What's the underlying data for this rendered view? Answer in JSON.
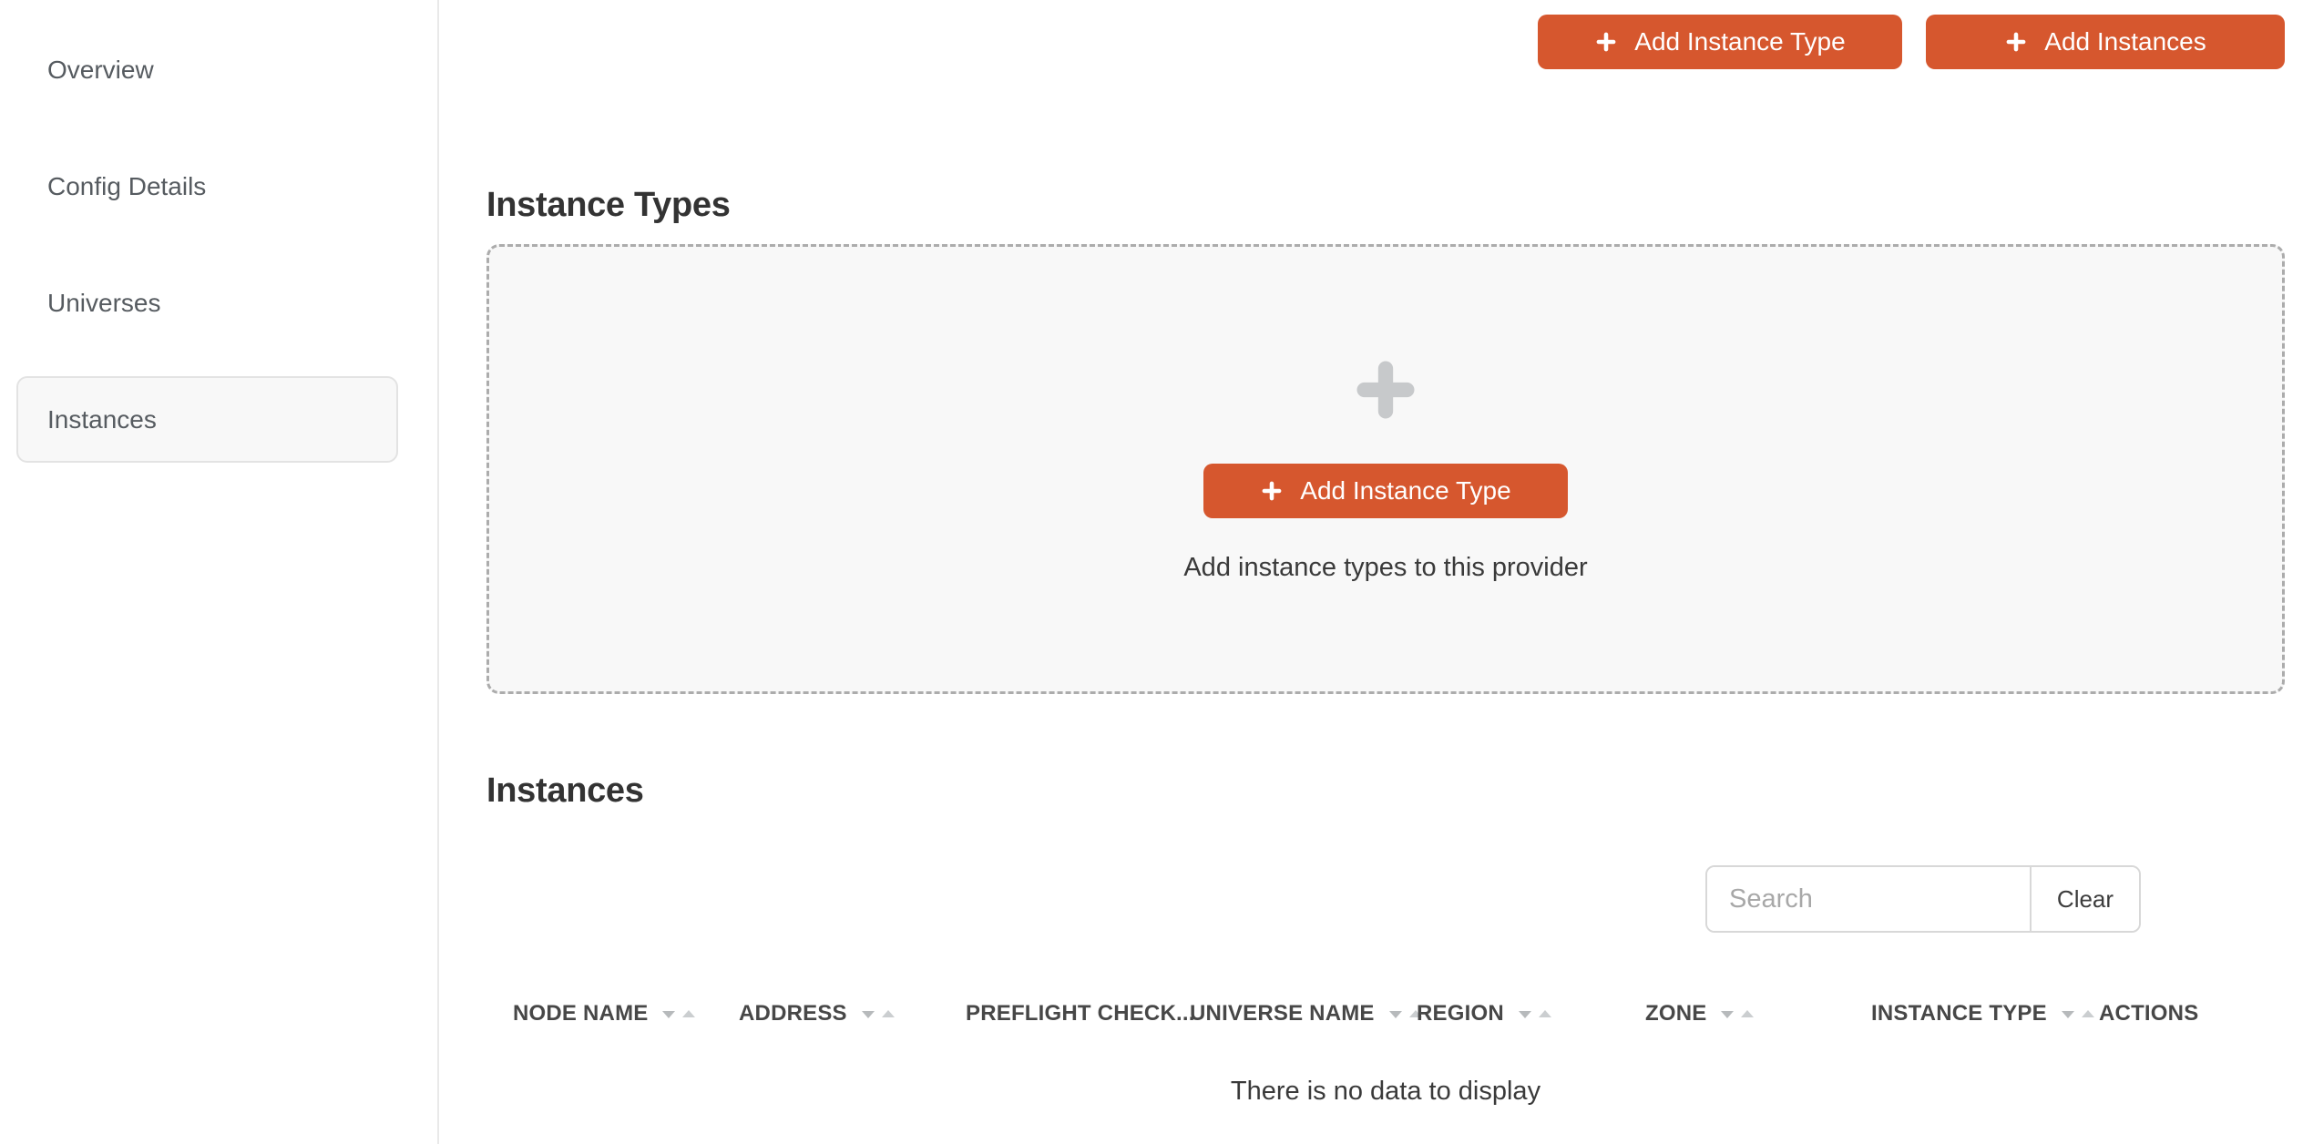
{
  "sidebar": {
    "items": [
      {
        "label": "Overview"
      },
      {
        "label": "Config Details"
      },
      {
        "label": "Universes"
      },
      {
        "label": "Instances"
      }
    ],
    "selected": "Instances"
  },
  "toolbar": {
    "add_instance_type_label": "Add Instance Type",
    "add_instances_label": "Add Instances"
  },
  "instance_types_section": {
    "title": "Instance Types",
    "empty_state": {
      "button_label": "Add Instance Type",
      "caption": "Add instance types to this provider"
    }
  },
  "instances_section": {
    "title": "Instances",
    "search": {
      "placeholder": "Search",
      "value": "",
      "clear_label": "Clear"
    },
    "table": {
      "columns": [
        {
          "label": "NODE NAME",
          "sortable": true
        },
        {
          "label": "ADDRESS",
          "sortable": true
        },
        {
          "label": "PREFLIGHT CHECK...",
          "sortable": false
        },
        {
          "label": "UNIVERSE NAME",
          "sortable": true
        },
        {
          "label": "REGION",
          "sortable": true
        },
        {
          "label": "ZONE",
          "sortable": true
        },
        {
          "label": "INSTANCE TYPE",
          "sortable": true
        },
        {
          "label": "ACTIONS",
          "sortable": false
        }
      ],
      "rows": [],
      "empty_message": "There is no data to display"
    }
  },
  "icons": {
    "plus_icon": "plus cross",
    "sort_desc_icon": "triangle-down",
    "sort_asc_icon": "triangle-up"
  },
  "colors": {
    "accent_orange": "#D6572E",
    "heading_text": "#333333",
    "body_text": "#3A3A3A",
    "sidebar_text": "#565B60",
    "panel_background": "#F8F8F8",
    "dashed_border": "#ACACAC",
    "muted_icon": "#C7C9CB",
    "sort_caret_dark": "#B7BABC",
    "sort_caret_light": "#CBCED0"
  }
}
